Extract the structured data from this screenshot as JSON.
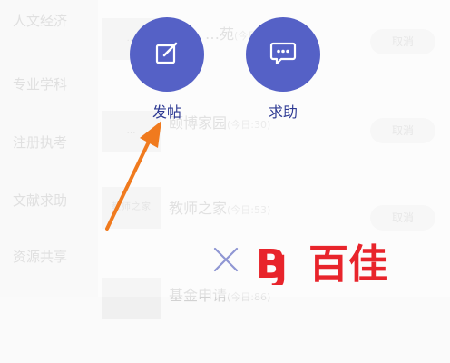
{
  "sidebar": {
    "items": [
      "人文经济",
      "专业学科",
      "注册执考",
      "文献求助",
      "资源共享"
    ]
  },
  "list": {
    "rows": [
      {
        "title": "…苑",
        "count": "(今日:12)",
        "thumb_text": "…",
        "action": "取消"
      },
      {
        "title": "颐博家园",
        "count": "(今日:30)",
        "thumb_text": "…",
        "action": "取消"
      },
      {
        "title": "教师之家",
        "count": "(今日:53)",
        "thumb_text": "教师之家",
        "action": "取消"
      },
      {
        "title": "基金申请",
        "count": "(今日:86)",
        "thumb_text": "",
        "action": ""
      }
    ]
  },
  "overlay": {
    "post_label": "发帖",
    "help_label": "求助"
  },
  "watermark": {
    "logo_text": "百佳"
  },
  "colors": {
    "action_bg": "#5561c6",
    "label": "#2e3a93",
    "arrow": "#f07a1e",
    "logo_red": "#e8242b"
  }
}
